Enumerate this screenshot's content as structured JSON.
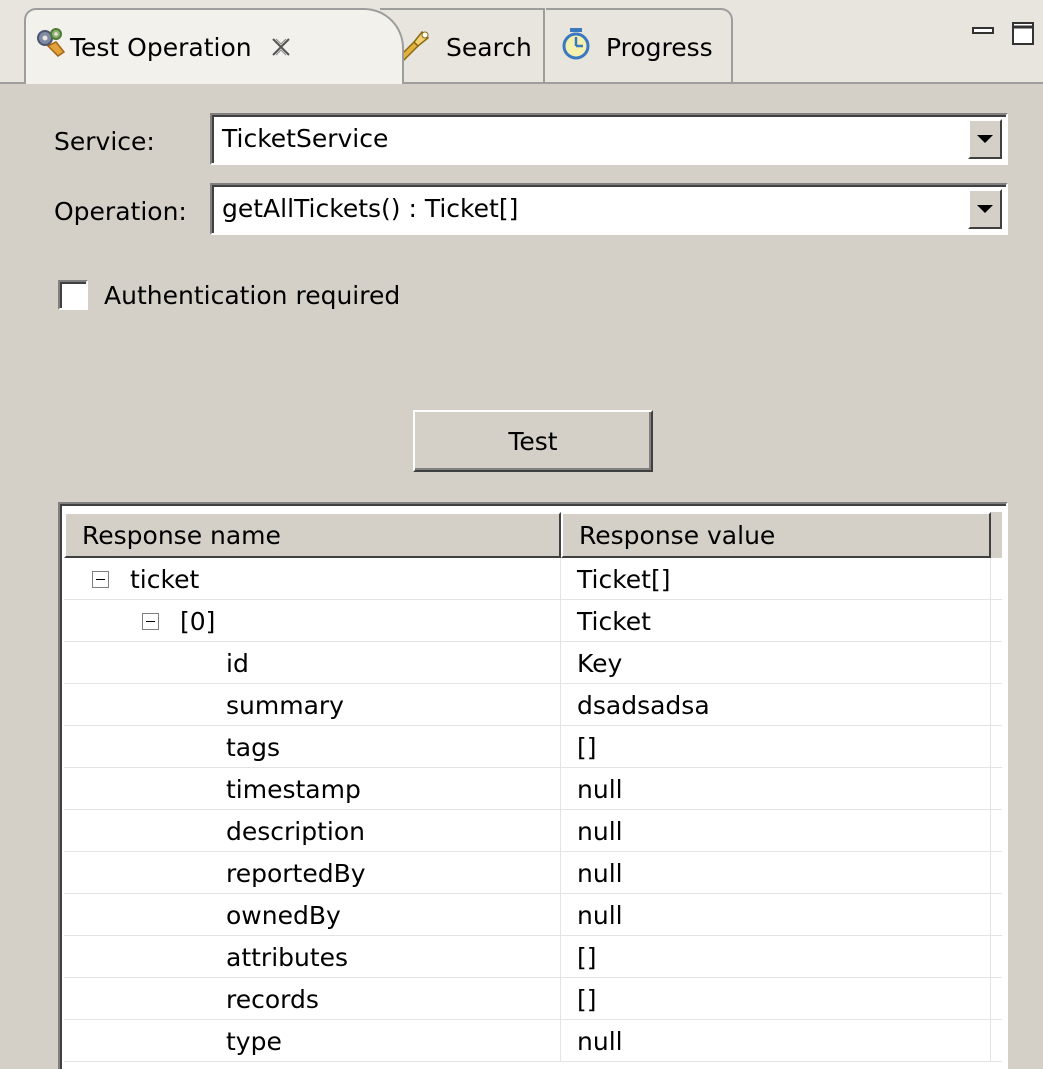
{
  "tabs": {
    "test_operation": "Test Operation",
    "search": "Search",
    "progress": "Progress"
  },
  "form": {
    "service_label": "Service:",
    "service_value": "TicketService",
    "operation_label": "Operation:",
    "operation_value": "getAllTickets() : Ticket[]",
    "auth_label": "Authentication required",
    "auth_checked": false,
    "test_button": "Test"
  },
  "table": {
    "headers": {
      "name": "Response name",
      "value": "Response value"
    },
    "rows": [
      {
        "name": "ticket",
        "value": "Ticket[]"
      },
      {
        "name": "[0]",
        "value": "Ticket"
      },
      {
        "name": "id",
        "value": "Key"
      },
      {
        "name": "summary",
        "value": "dsadsadsa"
      },
      {
        "name": "tags",
        "value": "[]"
      },
      {
        "name": "timestamp",
        "value": "null"
      },
      {
        "name": "description",
        "value": "null"
      },
      {
        "name": "reportedBy",
        "value": "null"
      },
      {
        "name": "ownedBy",
        "value": "null"
      },
      {
        "name": "attributes",
        "value": "[]"
      },
      {
        "name": "records",
        "value": "[]"
      },
      {
        "name": "type",
        "value": "null"
      }
    ]
  },
  "icons": {
    "test_operation": "gears-icon",
    "search": "flashlight-icon",
    "progress": "progress-icon",
    "close": "close-icon",
    "minimize": "minimize-icon",
    "maximize": "maximize-icon"
  }
}
